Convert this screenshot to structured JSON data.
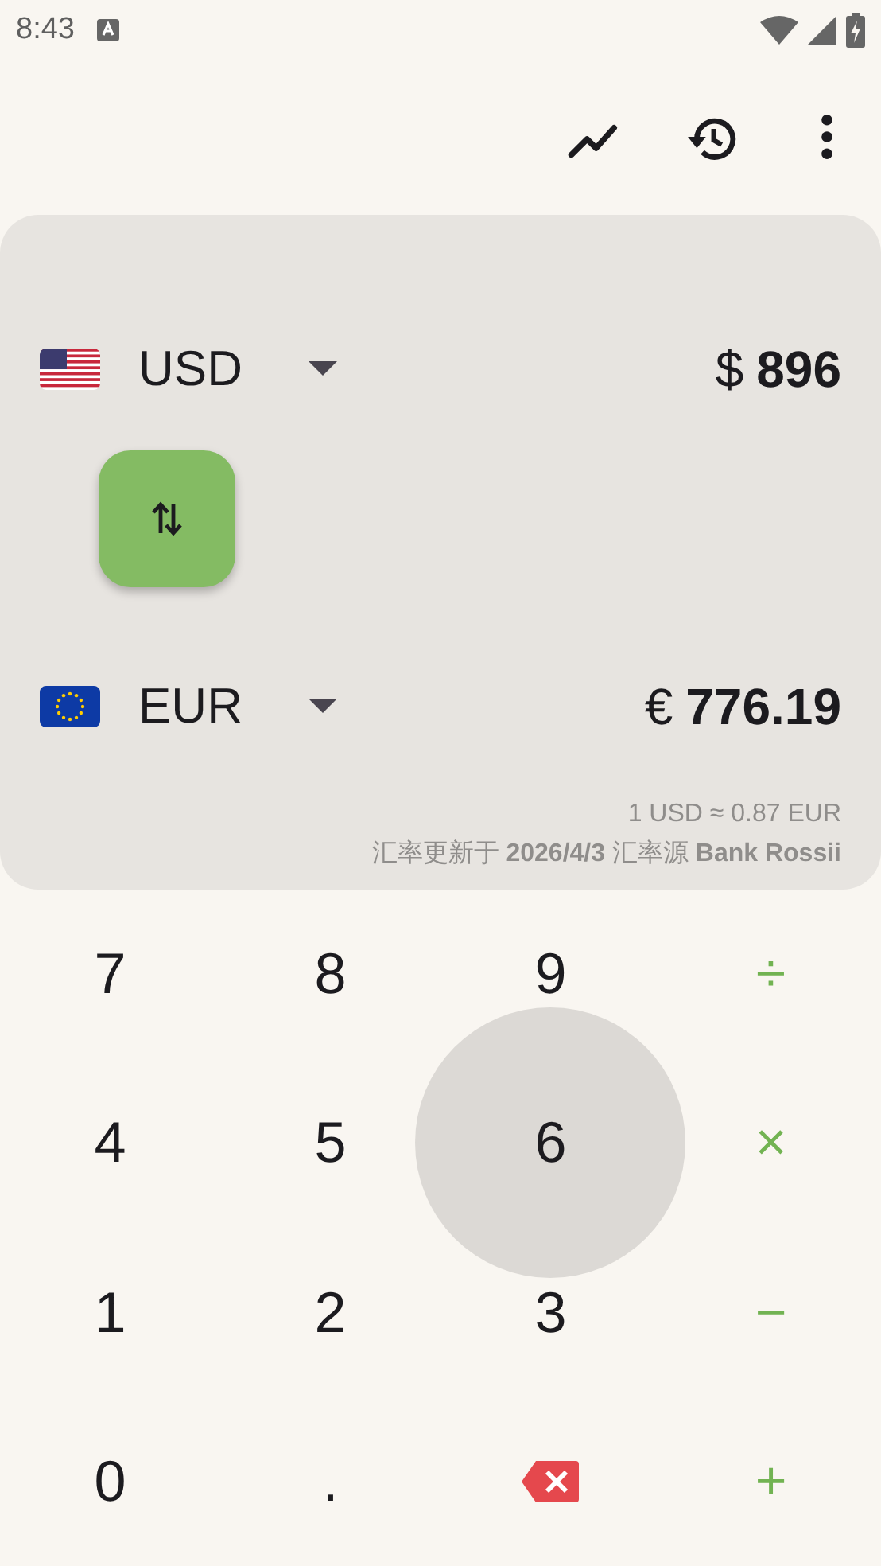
{
  "status_bar": {
    "time": "8:43",
    "charging": true
  },
  "toolbar": {
    "actions": [
      {
        "kind": "chart"
      },
      {
        "kind": "history"
      },
      {
        "kind": "more"
      }
    ]
  },
  "converter": {
    "currencies": [
      {
        "kind": "us",
        "code": "USD",
        "symbol": "$",
        "amount": "896"
      },
      {
        "kind": "eu",
        "code": "EUR",
        "symbol": "€",
        "amount": "776.19"
      }
    ],
    "rate": "1 USD ≈ 0.87 EUR",
    "info": "汇率更新于 **2026/4/3** 汇率源 **Bank Rossii**"
  },
  "keypad": [
    {
      "label": "7",
      "kind": "digit",
      "pressed": false
    },
    {
      "label": "8",
      "kind": "digit",
      "pressed": false
    },
    {
      "label": "9",
      "kind": "digit",
      "pressed": false
    },
    {
      "label": "÷",
      "kind": "operator",
      "pressed": false
    },
    {
      "label": "4",
      "kind": "digit",
      "pressed": false
    },
    {
      "label": "5",
      "kind": "digit",
      "pressed": false
    },
    {
      "label": "6",
      "kind": "digit",
      "pressed": true
    },
    {
      "label": "×",
      "kind": "operator",
      "pressed": false
    },
    {
      "label": "1",
      "kind": "digit",
      "pressed": false
    },
    {
      "label": "2",
      "kind": "digit",
      "pressed": false
    },
    {
      "label": "3",
      "kind": "digit",
      "pressed": false
    },
    {
      "label": "−",
      "kind": "operator",
      "pressed": false
    },
    {
      "label": "0",
      "kind": "digit",
      "pressed": false
    },
    {
      "label": ".",
      "kind": "digit",
      "pressed": false
    },
    {
      "kind": "backspace",
      "pressed": false
    },
    {
      "label": "+",
      "kind": "operator",
      "pressed": false
    }
  ]
}
